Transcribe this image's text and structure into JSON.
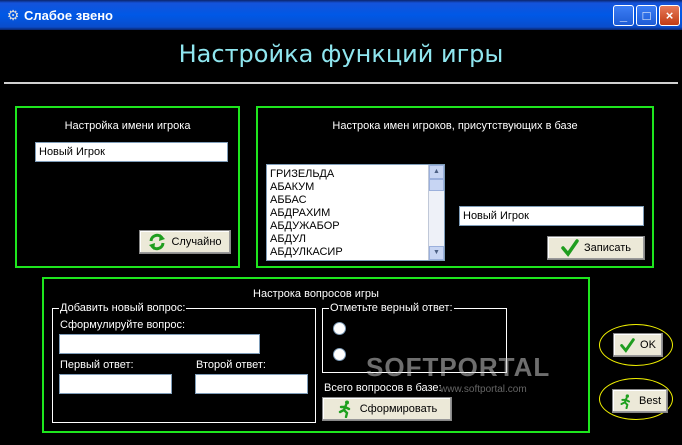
{
  "window": {
    "title": "Слабое звено",
    "minimize": "_",
    "maximize": "□",
    "close": "×"
  },
  "heading": "Настройка функций игры",
  "player_name": {
    "title": "Настройка имени игрока",
    "value": "Новый Игрок",
    "random_button": "Случайно"
  },
  "db_names": {
    "title": "Настрока имен игроков, присутствующих в базе",
    "list_items": [
      "ГРИЗЕЛЬДА",
      "АБАКУМ",
      "АББАС",
      "АБДРАХИМ",
      "АБДУЖАБОР",
      "АБДУЛ",
      "АБДУЛКАСИР"
    ],
    "edit_value": "Новый Игрок",
    "save_button": "Записать"
  },
  "questions": {
    "title": "Настрока вопросов игры",
    "add_legend": "Добавить новый вопрос:",
    "question_label": "Сформулируйте вопрос:",
    "first_answer_label": "Первый ответ:",
    "second_answer_label": "Второй ответ:",
    "correct_legend": "Отметьте верный ответ:",
    "total_label": "Всего вопросов в базе:",
    "form_button": "Сформировать"
  },
  "ok_button": "OK",
  "best_button": "Best",
  "watermark": {
    "main": "SOFTPORTAL",
    "sub": "www.softportal.com"
  },
  "colors": {
    "frame_border": "#1ee61e",
    "heading": "#8fe6ef",
    "background": "#000000",
    "highlight_oval": "#f0f000"
  }
}
